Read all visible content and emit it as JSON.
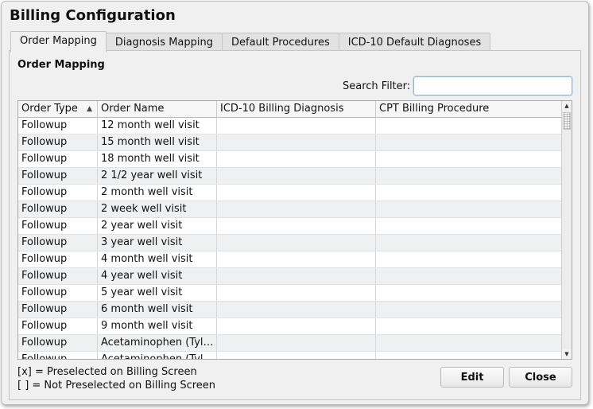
{
  "window": {
    "title": "Billing Configuration"
  },
  "tabs": [
    {
      "label": "Order Mapping",
      "active": true
    },
    {
      "label": "Diagnosis Mapping",
      "active": false
    },
    {
      "label": "Default Procedures",
      "active": false
    },
    {
      "label": "ICD-10 Default Diagnoses",
      "active": false
    }
  ],
  "panel": {
    "heading": "Order Mapping",
    "search": {
      "label": "Search Filter:",
      "value": "",
      "placeholder": ""
    }
  },
  "table": {
    "columns": [
      "Order Type",
      "Order Name",
      "ICD-10 Billing Diagnosis",
      "CPT Billing Procedure"
    ],
    "sort_indicator": "▲",
    "rows": [
      [
        "Followup",
        "12 month well visit",
        "",
        ""
      ],
      [
        "Followup",
        "15 month well visit",
        "",
        ""
      ],
      [
        "Followup",
        "18 month well visit",
        "",
        ""
      ],
      [
        "Followup",
        "2 1/2 year well visit",
        "",
        ""
      ],
      [
        "Followup",
        "2 month well visit",
        "",
        ""
      ],
      [
        "Followup",
        "2 week well visit",
        "",
        ""
      ],
      [
        "Followup",
        "2 year well visit",
        "",
        ""
      ],
      [
        "Followup",
        "3 year well visit",
        "",
        ""
      ],
      [
        "Followup",
        "4 month well visit",
        "",
        ""
      ],
      [
        "Followup",
        "4 year well visit",
        "",
        ""
      ],
      [
        "Followup",
        "5 year well visit",
        "",
        ""
      ],
      [
        "Followup",
        "6 month well visit",
        "",
        ""
      ],
      [
        "Followup",
        "9 month well visit",
        "",
        ""
      ],
      [
        "Followup",
        "Acetaminophen (Tyle...",
        "",
        ""
      ],
      [
        "Followup",
        "Acetaminophen (Tyle...",
        "",
        ""
      ]
    ],
    "scroll": {
      "up_glyph": "▲",
      "down_glyph": "▼"
    }
  },
  "legend": {
    "line1": "[x] = Preselected on Billing Screen",
    "line2": "[ ] = Not Preselected on Billing Screen"
  },
  "buttons": {
    "edit": "Edit",
    "close": "Close"
  },
  "colors": {
    "row_alt": "#eef0f1",
    "search_focus": "#8fb3d9",
    "window_bg": "#f0f0f0"
  }
}
